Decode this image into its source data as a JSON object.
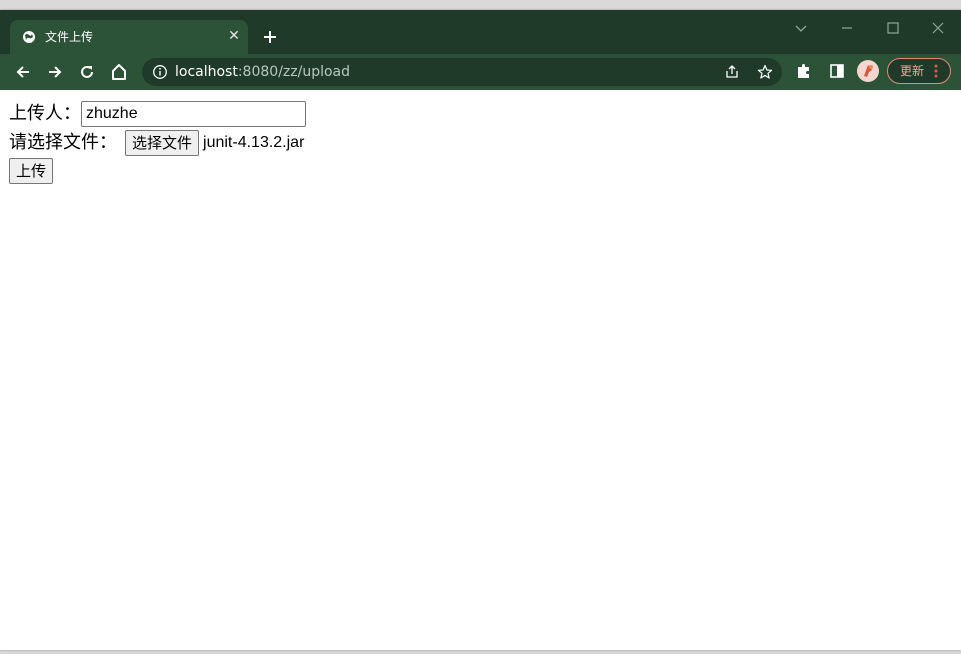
{
  "browser": {
    "tab_title": "文件上传",
    "tab_close_glyph": "✕",
    "url_host": "localhost",
    "url_path": ":8080/zz/upload",
    "update_label": "更新",
    "accent": "#2c5238",
    "frame": "#1f3a28"
  },
  "form": {
    "uploader_label": "上传人：",
    "uploader_value": "zhuzhe",
    "file_label": "请选择文件：",
    "choose_file_label": "选择文件",
    "file_name": "junit-4.13.2.jar",
    "submit_label": "上传"
  }
}
